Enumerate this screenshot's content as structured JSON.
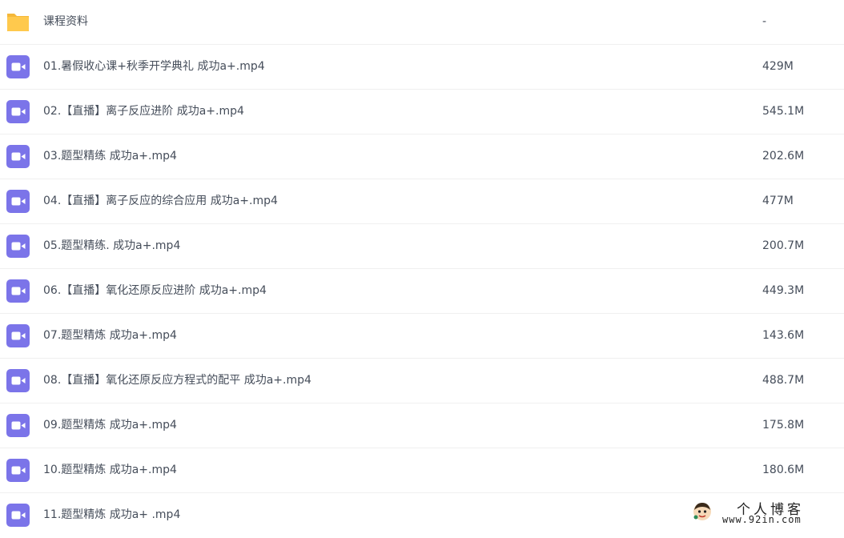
{
  "colors": {
    "folder": "#ffc94d",
    "folder_tab": "#f5b83a",
    "video_icon": "#7b74e9",
    "text": "#454d5a",
    "divider": "#f0f0f0"
  },
  "files": [
    {
      "icon": "folder-icon",
      "name": "课程资料",
      "size": "-"
    },
    {
      "icon": "video-file-icon",
      "name": "01.暑假收心课+秋季开学典礼 成功a+.mp4",
      "size": "429M"
    },
    {
      "icon": "video-file-icon",
      "name": "02.【直播】离子反应进阶 成功a+.mp4",
      "size": "545.1M"
    },
    {
      "icon": "video-file-icon",
      "name": "03.题型精练 成功a+.mp4",
      "size": "202.6M"
    },
    {
      "icon": "video-file-icon",
      "name": "04.【直播】离子反应的综合应用 成功a+.mp4",
      "size": "477M"
    },
    {
      "icon": "video-file-icon",
      "name": "05.题型精练. 成功a+.mp4",
      "size": "200.7M"
    },
    {
      "icon": "video-file-icon",
      "name": "06.【直播】氧化还原反应进阶 成功a+.mp4",
      "size": "449.3M"
    },
    {
      "icon": "video-file-icon",
      "name": "07.题型精炼 成功a+.mp4",
      "size": "143.6M"
    },
    {
      "icon": "video-file-icon",
      "name": "08.【直播】氧化还原反应方程式的配平 成功a+.mp4",
      "size": "488.7M"
    },
    {
      "icon": "video-file-icon",
      "name": "09.题型精炼 成功a+.mp4",
      "size": "175.8M"
    },
    {
      "icon": "video-file-icon",
      "name": "10.题型精炼 成功a+.mp4",
      "size": "180.6M"
    },
    {
      "icon": "video-file-icon",
      "name": "11.题型精炼 成功a+ .mp4",
      "size": ""
    }
  ],
  "watermark": {
    "title": "个人博客",
    "url": "www.92in.com"
  }
}
